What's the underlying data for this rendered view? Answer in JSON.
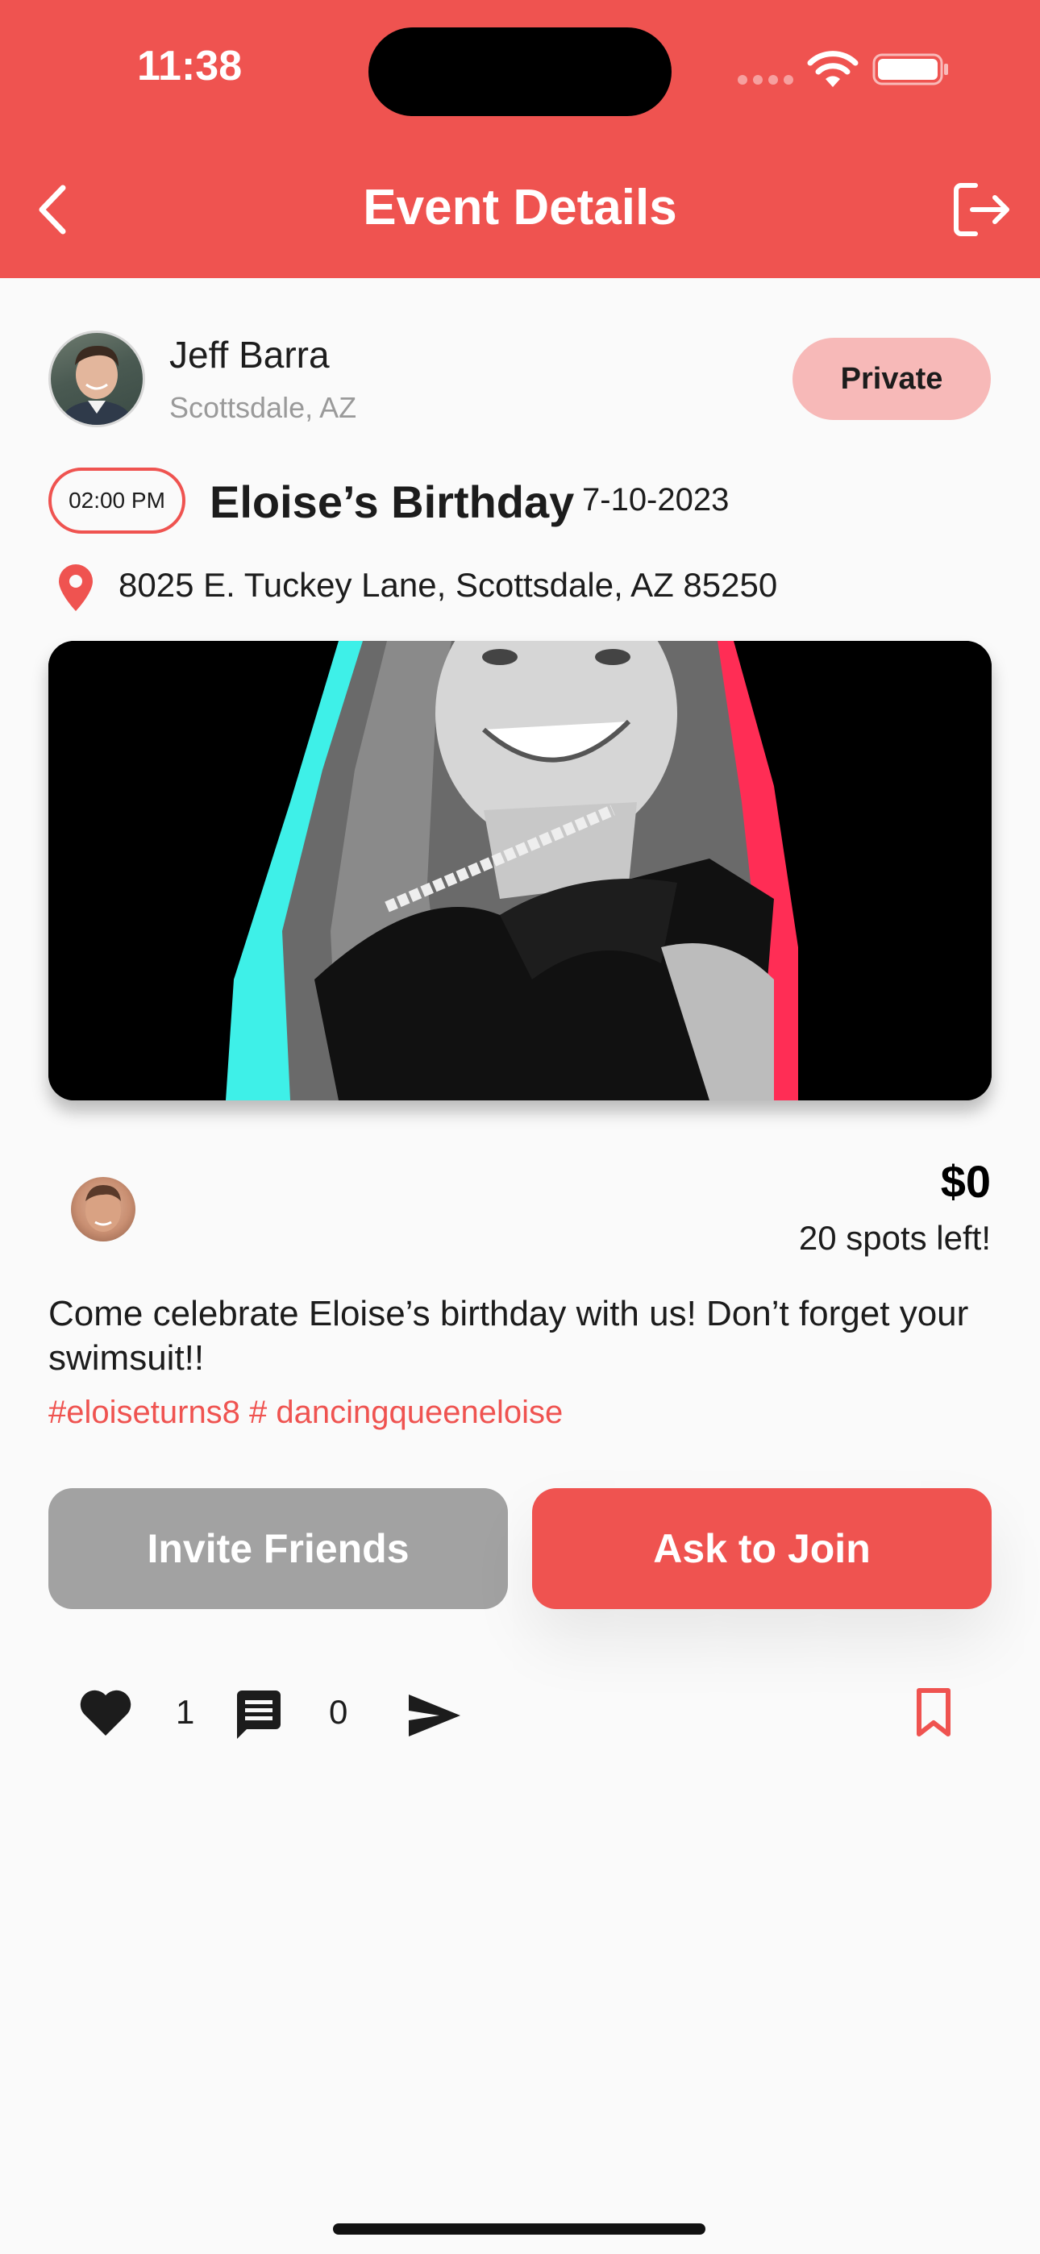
{
  "status_bar": {
    "time": "11:38"
  },
  "header": {
    "title": "Event Details"
  },
  "host": {
    "name": "Jeff Barra",
    "location": "Scottsdale, AZ",
    "privacy": "Private"
  },
  "event": {
    "time": "02:00 PM",
    "title": "Eloise’s Birthday",
    "date": "7-10-2023",
    "address": "8025 E. Tuckey Lane, Scottsdale, AZ 85250",
    "price": "$0",
    "spots": "20 spots left!",
    "description": "Come celebrate Eloise’s birthday with us! Don’t forget your swimsuit!!",
    "hashtags": "#eloiseturns8 # dancingqueeneloise"
  },
  "actions": {
    "invite_label": "Invite Friends",
    "join_label": "Ask to Join"
  },
  "engagement": {
    "likes": "1",
    "comments": "0"
  },
  "icons": {
    "back": "chevron-left-icon",
    "logout": "logout-icon",
    "pin": "location-pin-icon",
    "heart": "heart-icon",
    "comment": "comment-icon",
    "share": "send-icon",
    "bookmark": "bookmark-icon"
  },
  "colors": {
    "accent": "#ef5350",
    "badge_bg": "#f7b9b8",
    "secondary_button": "#a2a2a2"
  }
}
